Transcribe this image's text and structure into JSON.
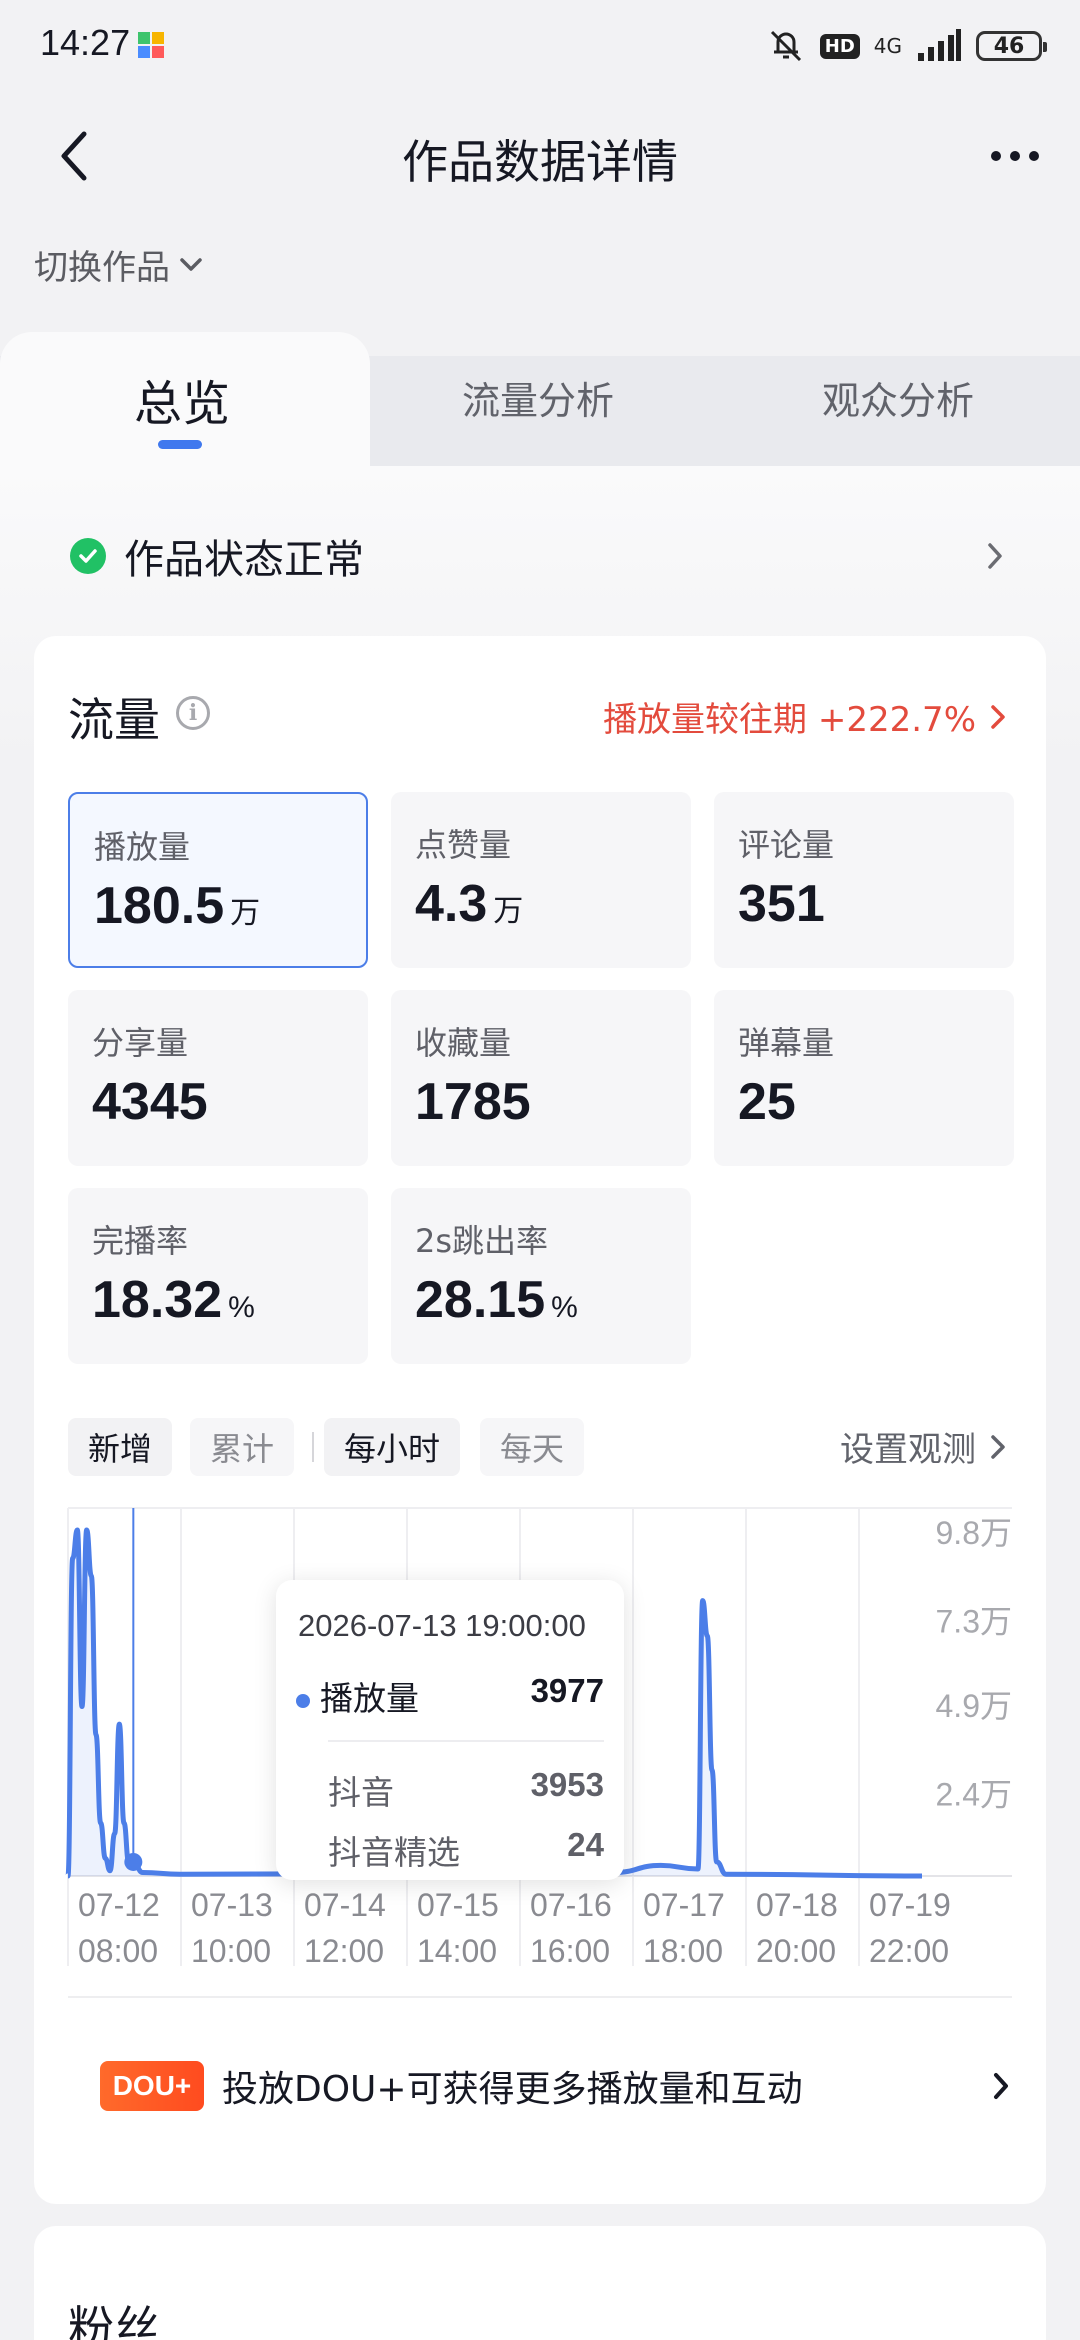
{
  "status_bar": {
    "time": "14:27",
    "network": "4G",
    "hd": "HD",
    "battery": "46"
  },
  "nav": {
    "title": "作品数据详情"
  },
  "switch_work": "切换作品",
  "tabs": [
    {
      "label": "总览",
      "active": true
    },
    {
      "label": "流量分析",
      "active": false
    },
    {
      "label": "观众分析",
      "active": false
    }
  ],
  "work_status": "作品状态正常",
  "traffic": {
    "title": "流量",
    "compare_text": "播放量较往期 +222.7%",
    "metrics": [
      {
        "label": "播放量",
        "value": "180.5",
        "unit": "万",
        "selected": true
      },
      {
        "label": "点赞量",
        "value": "4.3",
        "unit": "万"
      },
      {
        "label": "评论量",
        "value": "351",
        "unit": ""
      },
      {
        "label": "分享量",
        "value": "4345",
        "unit": ""
      },
      {
        "label": "收藏量",
        "value": "1785",
        "unit": ""
      },
      {
        "label": "弹幕量",
        "value": "25",
        "unit": ""
      },
      {
        "label": "完播率",
        "value": "18.32",
        "unit": "%"
      },
      {
        "label": "2s跳出率",
        "value": "28.15",
        "unit": "%"
      }
    ],
    "chips": {
      "new": "新增",
      "cumulative": "累计",
      "hourly": "每小时",
      "daily": "每天"
    },
    "setup": "设置观测"
  },
  "chart_data": {
    "type": "line",
    "y_tick_labels": [
      "9.8万",
      "7.3万",
      "4.9万",
      "2.4万"
    ],
    "y_ticks": [
      98000,
      73000,
      49000,
      24000
    ],
    "ylim": [
      0,
      98000
    ],
    "x_tick_dates": [
      "07-12",
      "07-13",
      "07-14",
      "07-15",
      "07-16",
      "07-17",
      "07-18",
      "07-19"
    ],
    "x_tick_times": [
      "08:00",
      "10:00",
      "12:00",
      "14:00",
      "16:00",
      "18:00",
      "20:00",
      "22:00"
    ],
    "color": "#4c7ee8",
    "series": [
      {
        "values": [
          {
            "x": "2026-07-12 05:00",
            "y": 0
          },
          {
            "x": "2026-07-12 06:00",
            "y": 90000
          },
          {
            "x": "2026-07-12 07:00",
            "y": 98000
          },
          {
            "x": "2026-07-12 08:00",
            "y": 48000
          },
          {
            "x": "2026-07-12 09:00",
            "y": 98000
          },
          {
            "x": "2026-07-12 10:00",
            "y": 85000
          },
          {
            "x": "2026-07-12 11:00",
            "y": 40000
          },
          {
            "x": "2026-07-12 12:00",
            "y": 15000
          },
          {
            "x": "2026-07-12 13:00",
            "y": 5000
          },
          {
            "x": "2026-07-12 14:00",
            "y": 1500
          },
          {
            "x": "2026-07-12 15:00",
            "y": 12000
          },
          {
            "x": "2026-07-12 16:00",
            "y": 43000
          },
          {
            "x": "2026-07-12 17:00",
            "y": 15000
          },
          {
            "x": "2026-07-12 18:00",
            "y": 4000
          },
          {
            "x": "2026-07-12 19:00",
            "y": 3977
          },
          {
            "x": "2026-07-12 21:00",
            "y": 1000
          },
          {
            "x": "2026-07-13 05:00",
            "y": 500
          },
          {
            "x": "2026-07-16 10:00",
            "y": 800
          },
          {
            "x": "2026-07-16 20:00",
            "y": 8000
          },
          {
            "x": "2026-07-17 02:00",
            "y": 1000
          },
          {
            "x": "2026-07-17 12:00",
            "y": 3000
          },
          {
            "x": "2026-07-17 20:00",
            "y": 2000
          },
          {
            "x": "2026-07-17 21:00",
            "y": 78000
          },
          {
            "x": "2026-07-17 22:00",
            "y": 68000
          },
          {
            "x": "2026-07-17 23:00",
            "y": 30000
          },
          {
            "x": "2026-07-18 00:00",
            "y": 4000
          },
          {
            "x": "2026-07-18 02:00",
            "y": 500
          },
          {
            "x": "2026-07-19 20:00",
            "y": 0
          }
        ]
      }
    ],
    "tooltip": {
      "time": "2026-07-13 19:00:00",
      "series_label": "播放量",
      "series_value": "3977",
      "rows": [
        {
          "label": "抖音",
          "value": "3953"
        },
        {
          "label": "抖音精选",
          "value": "24"
        }
      ]
    }
  },
  "dou_plus": {
    "logo": "DOU+",
    "text": "投放DOU+可获得更多播放量和互动"
  },
  "fans": {
    "title": "粉丝"
  }
}
